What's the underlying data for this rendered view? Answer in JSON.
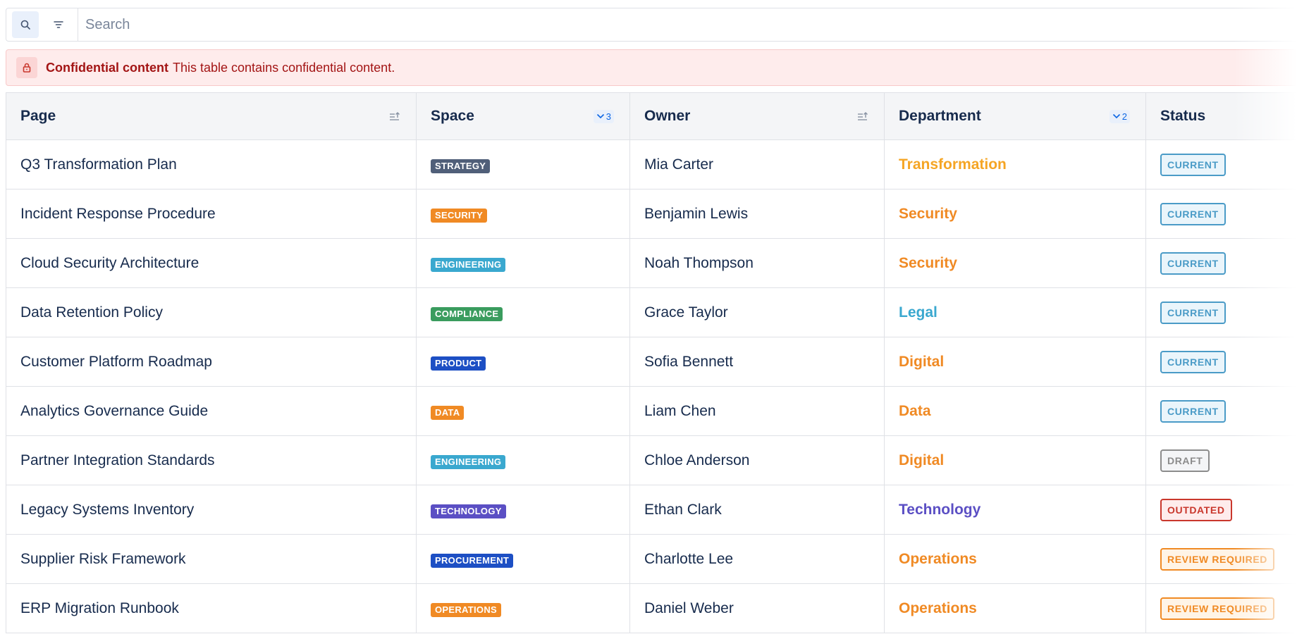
{
  "search": {
    "placeholder": "Search"
  },
  "banner": {
    "title": "Confidential content",
    "text": "This table contains confidential content."
  },
  "table": {
    "headers": {
      "page": "Page",
      "space": "Space",
      "owner": "Owner",
      "department": "Department",
      "status": "Status"
    },
    "filters": {
      "space_count": "3",
      "department_count": "2"
    },
    "rows": [
      {
        "page": "Q3 Transformation Plan",
        "space": "STRATEGY",
        "space_color": "#505f79",
        "owner": "Mia Carter",
        "department": "Transformation",
        "dept_color": "#f5a524",
        "status": "CURRENT",
        "status_color": "#4a9bc7",
        "status_bg": "#eaf5fb"
      },
      {
        "page": "Incident Response Procedure",
        "space": "SECURITY",
        "space_color": "#f08a24",
        "owner": "Benjamin Lewis",
        "department": "Security",
        "dept_color": "#f08a24",
        "status": "CURRENT",
        "status_color": "#4a9bc7",
        "status_bg": "#eaf5fb"
      },
      {
        "page": "Cloud Security Architecture",
        "space": "ENGINEERING",
        "space_color": "#3aa8cf",
        "owner": "Noah Thompson",
        "department": "Security",
        "dept_color": "#f08a24",
        "status": "CURRENT",
        "status_color": "#4a9bc7",
        "status_bg": "#eaf5fb"
      },
      {
        "page": "Data Retention Policy",
        "space": "COMPLIANCE",
        "space_color": "#3a9c5e",
        "owner": "Grace Taylor",
        "department": "Legal",
        "dept_color": "#3aa8cf",
        "status": "CURRENT",
        "status_color": "#4a9bc7",
        "status_bg": "#eaf5fb"
      },
      {
        "page": "Customer Platform Roadmap",
        "space": "PRODUCT",
        "space_color": "#1d4fc4",
        "owner": "Sofia Bennett",
        "department": "Digital",
        "dept_color": "#f08a24",
        "status": "CURRENT",
        "status_color": "#4a9bc7",
        "status_bg": "#eaf5fb"
      },
      {
        "page": "Analytics Governance Guide",
        "space": "DATA",
        "space_color": "#f08a24",
        "owner": "Liam Chen",
        "department": "Data",
        "dept_color": "#f08a24",
        "status": "CURRENT",
        "status_color": "#4a9bc7",
        "status_bg": "#eaf5fb"
      },
      {
        "page": "Partner Integration Standards",
        "space": "ENGINEERING",
        "space_color": "#3aa8cf",
        "owner": "Chloe Anderson",
        "department": "Digital",
        "dept_color": "#f08a24",
        "status": "DRAFT",
        "status_color": "#8c8c8c",
        "status_bg": "#f4f5f7"
      },
      {
        "page": "Legacy Systems Inventory",
        "space": "TECHNOLOGY",
        "space_color": "#5b4fc4",
        "owner": "Ethan Clark",
        "department": "Technology",
        "dept_color": "#5b4fc4",
        "status": "OUTDATED",
        "status_color": "#c9372c",
        "status_bg": "#feecec"
      },
      {
        "page": "Supplier Risk Framework",
        "space": "PROCUREMENT",
        "space_color": "#1d4fc4",
        "owner": "Charlotte Lee",
        "department": "Operations",
        "dept_color": "#f08a24",
        "status": "REVIEW REQUIRED",
        "status_color": "#f08a24",
        "status_bg": "#fff4e6"
      },
      {
        "page": "ERP Migration Runbook",
        "space": "OPERATIONS",
        "space_color": "#f08a24",
        "owner": "Daniel Weber",
        "department": "Operations",
        "dept_color": "#f08a24",
        "status": "REVIEW REQUIRED",
        "status_color": "#f08a24",
        "status_bg": "#fff4e6"
      }
    ]
  }
}
